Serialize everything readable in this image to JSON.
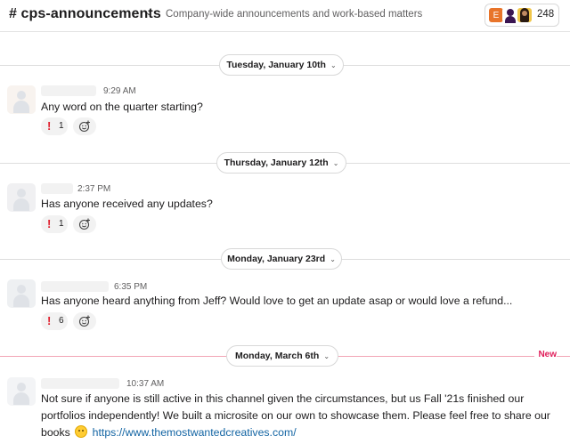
{
  "header": {
    "channel_name": "# cps-announcements",
    "description": "Company-wide announcements and work-based matters",
    "member_avatar_initial": "E",
    "member_count": "248",
    "icons": [
      "chevron-down-icon",
      "member-avatars"
    ]
  },
  "dividers": [
    {
      "label": "Tuesday, January 10th"
    },
    {
      "label": "Thursday, January 12th"
    },
    {
      "label": "Monday, January 23rd"
    },
    {
      "label": "Monday, March 6th",
      "new_label": "New"
    }
  ],
  "messages": [
    {
      "time": "9:29 AM",
      "text": "Any word on the quarter starting?",
      "reaction_count": "1"
    },
    {
      "time": "2:37 PM",
      "text": "Has anyone received any updates?",
      "reaction_count": "1"
    },
    {
      "time": "6:35 PM",
      "text": "Has anyone heard anything from Jeff? Would love to get an update asap or would love a refund...",
      "reaction_count": "6"
    },
    {
      "time": "10:37 AM",
      "line1": "Not sure if anyone is still active in this channel given the circumstances, but us Fall '21s finished our",
      "line2": "portfolios independently! We built a microsite on our own to showcase them. Please feel free to share our",
      "line3_prefix": "books",
      "link": "https://www.themostwantedcreatives.com/"
    }
  ],
  "colors": {
    "accent_new": "#e01e5a",
    "link": "#1264a3",
    "reaction_icon": "#e01e2d"
  }
}
